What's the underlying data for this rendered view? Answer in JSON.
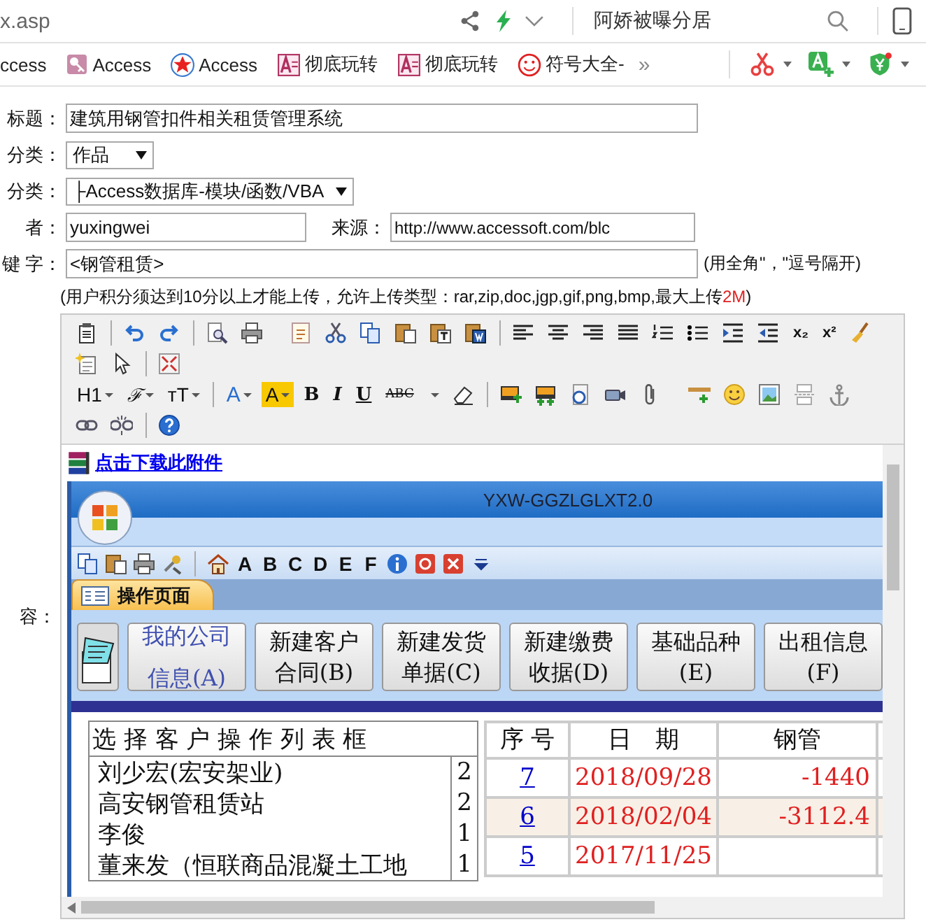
{
  "browser": {
    "url": "x.asp",
    "search_text": "阿娇被曝分居"
  },
  "bookmarks": [
    {
      "label": "ccess",
      "kind": "plain"
    },
    {
      "label": "Access",
      "kind": "key"
    },
    {
      "label": "Access",
      "kind": "star"
    },
    {
      "label": "彻底玩转",
      "kind": "doc"
    },
    {
      "label": "彻底玩转",
      "kind": "doc"
    },
    {
      "label": "符号大全-",
      "kind": "smiley"
    }
  ],
  "bookmarks_more": "»",
  "form": {
    "title": {
      "label": "标题：",
      "value": "建筑用钢管扣件相关租赁管理系统"
    },
    "category": {
      "label": "分类：",
      "value": "作品"
    },
    "subcategory": {
      "label": "分类：",
      "value": "├Access数据库-模块/函数/VBA"
    },
    "author": {
      "label": "者：",
      "value": "yuxingwei"
    },
    "source": {
      "label": "来源：",
      "value": "http://www.accessoft.com/blc"
    },
    "keywords": {
      "label": "键 字：",
      "value": "<钢管租赁>",
      "note": "(用全角\"，\"逗号隔开)"
    },
    "upload_hint": {
      "text": "(用户积分须达到10分以上才能上传，允许上传类型：rar,zip,doc,jgp,gif,png,bmp,最大上传",
      "limit": "2M",
      "close": ")"
    }
  },
  "editor": {
    "label": "容：",
    "toolbar_labels": [
      "x₂",
      "x²",
      "H1",
      "ℱ",
      "ᴛT",
      "A",
      "A",
      "B",
      "I",
      "U",
      "ABC"
    ],
    "attachment_link": "点击下载此附件"
  },
  "app": {
    "title": "YXW-GGZLGLXT2.0",
    "qat_letters": [
      "A",
      "B",
      "C",
      "D",
      "E",
      "F"
    ],
    "tab": "操作页面",
    "buttons": [
      {
        "lines": [
          "我的公司",
          "信息(A)"
        ],
        "selected": true
      },
      {
        "lines": [
          "新建客户",
          "合同(B)"
        ],
        "selected": false
      },
      {
        "lines": [
          "新建发货",
          "单据(C)"
        ],
        "selected": false
      },
      {
        "lines": [
          "新建缴费",
          "收据(D)"
        ],
        "selected": false
      },
      {
        "lines": [
          "基础品种",
          "(E)"
        ],
        "selected": false
      },
      {
        "lines": [
          "出租信息",
          "(F)"
        ],
        "selected": false
      }
    ],
    "list": {
      "header": "选 择 客 户 操 作 列 表 框",
      "rows": [
        {
          "name": "刘少宏(宏安架业)",
          "count": "2"
        },
        {
          "name": "高安钢管租赁站",
          "count": "2"
        },
        {
          "name": "李俊",
          "count": "1"
        },
        {
          "name": "董来发（恒联商品混凝土工地",
          "count": "1"
        }
      ]
    },
    "table": {
      "columns": [
        "序 号",
        "日　期",
        "钢管"
      ],
      "rows": [
        {
          "no": "7",
          "date": "2018/09/28",
          "steel": "-1440"
        },
        {
          "no": "6",
          "date": "2018/02/04",
          "steel": "-3112.4"
        },
        {
          "no": "5",
          "date": "2017/11/25"
        }
      ]
    }
  }
}
